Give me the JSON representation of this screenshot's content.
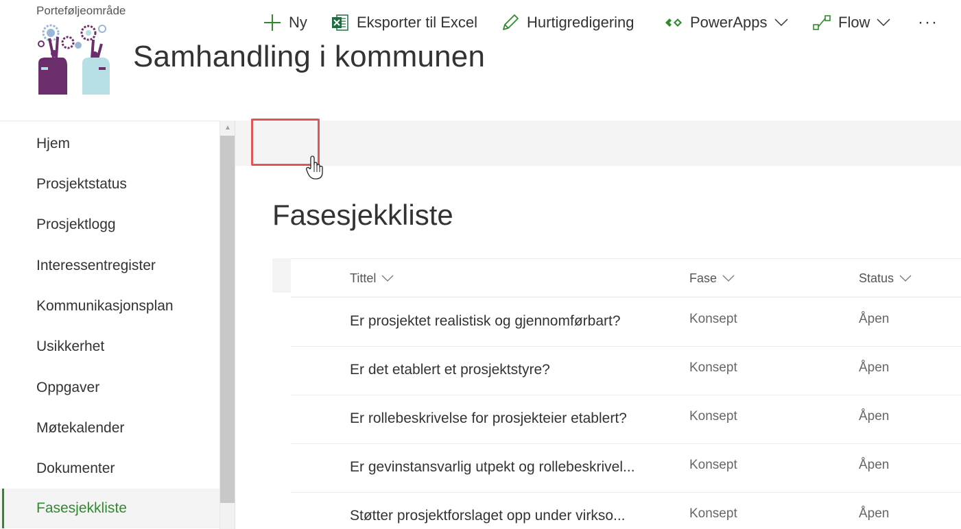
{
  "header": {
    "breadcrumb": "Porteføljeområde",
    "site_title": "Samhandling i kommunen",
    "logo_icon": "collaboration-logo"
  },
  "leftnav": {
    "items": [
      {
        "label": "Hjem",
        "active": false
      },
      {
        "label": "Prosjektstatus",
        "active": false
      },
      {
        "label": "Prosjektlogg",
        "active": false
      },
      {
        "label": "Interessentregister",
        "active": false
      },
      {
        "label": "Kommunikasjonsplan",
        "active": false
      },
      {
        "label": "Usikkerhet",
        "active": false
      },
      {
        "label": "Oppgaver",
        "active": false
      },
      {
        "label": "Møtekalender",
        "active": false
      },
      {
        "label": "Dokumenter",
        "active": false
      },
      {
        "label": "Fasesjekkliste",
        "active": true
      }
    ]
  },
  "commandbar": {
    "new_label": "Ny",
    "export_label": "Eksporter til Excel",
    "quickedit_label": "Hurtigredigering",
    "powerapps_label": "PowerApps",
    "flow_label": "Flow",
    "more_label": "···"
  },
  "list": {
    "title": "Fasesjekkliste",
    "columns": {
      "title": "Tittel",
      "fase": "Fase",
      "status": "Status"
    },
    "rows": [
      {
        "title": "Er prosjektet realistisk og gjennomførbart?",
        "fase": "Konsept",
        "status": "Åpen"
      },
      {
        "title": "Er det etablert et prosjektstyre?",
        "fase": "Konsept",
        "status": "Åpen"
      },
      {
        "title": "Er rollebeskrivelse for prosjekteier etablert?",
        "fase": "Konsept",
        "status": "Åpen"
      },
      {
        "title": "Er gevinstansvarlig utpekt og rollebeskrivel...",
        "fase": "Konsept",
        "status": "Åpen"
      },
      {
        "title": "Støtter prosjektforslaget opp under virkso...",
        "fase": "Konsept",
        "status": "Åpen"
      }
    ]
  },
  "colors": {
    "accent_green": "#2f8a2f",
    "highlight_red": "#e05555",
    "excel_green": "#1d6f42"
  }
}
